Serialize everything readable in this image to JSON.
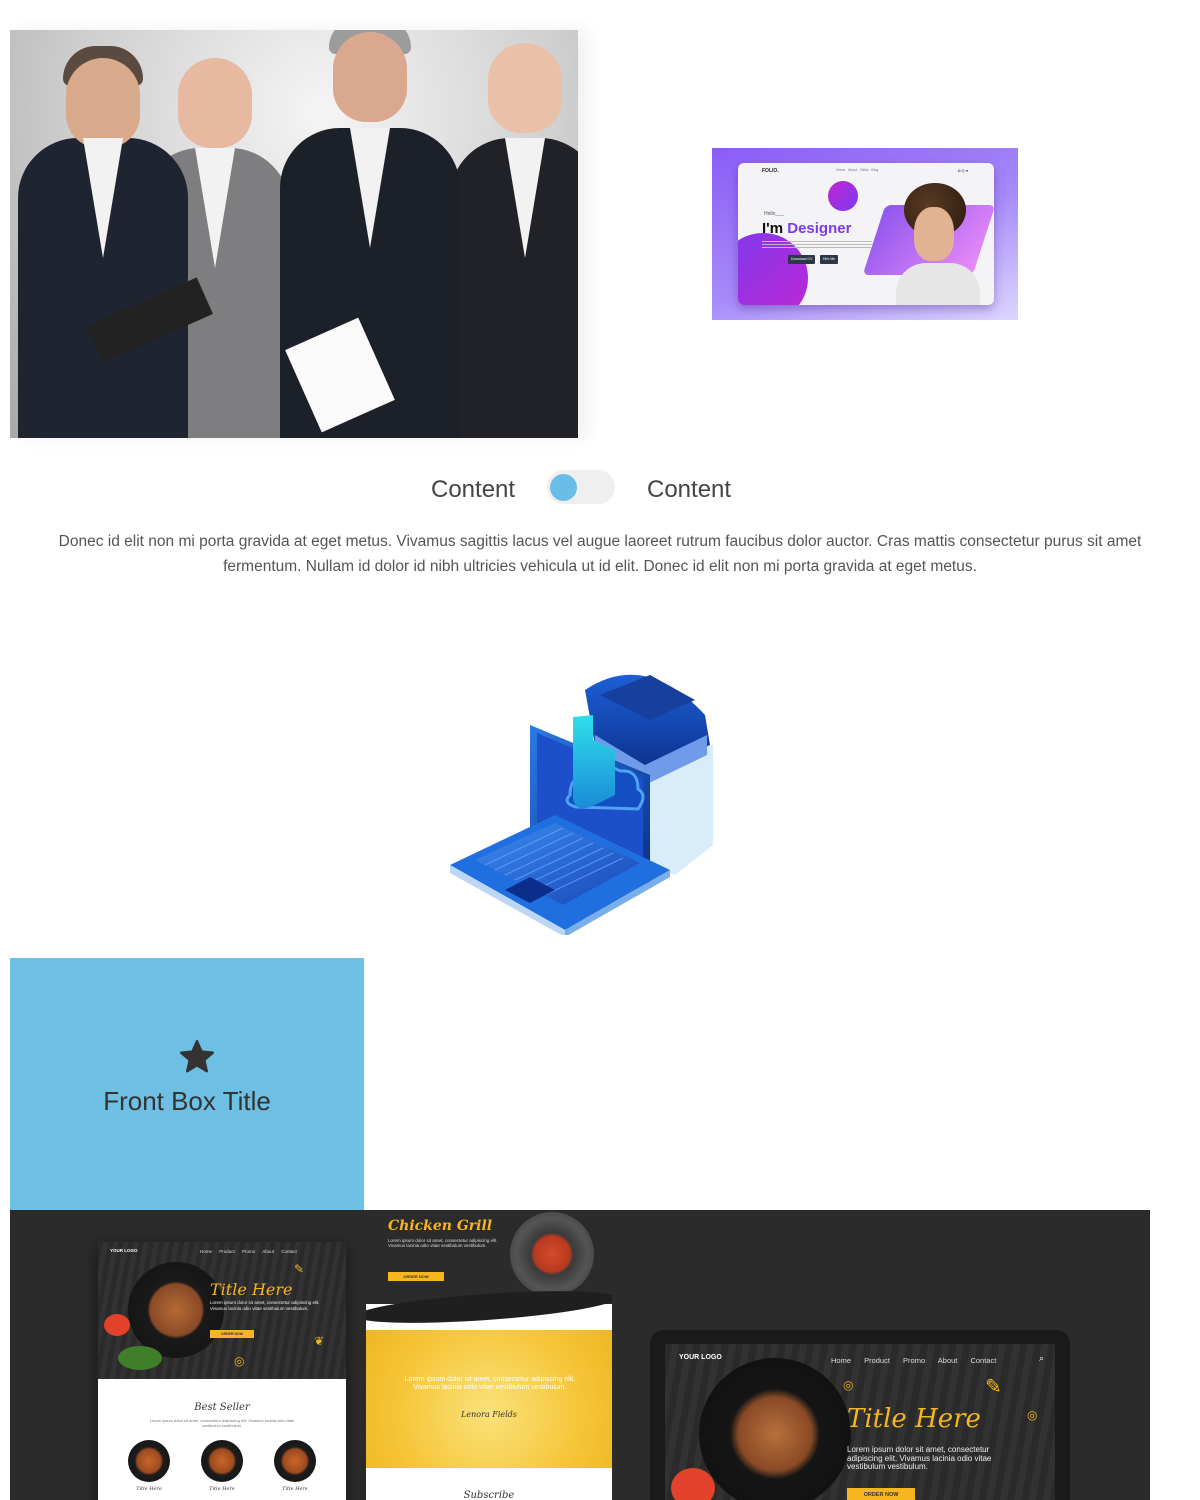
{
  "colors": {
    "accent_blue": "#6dbfe4",
    "toggle_knob": "#69bde7",
    "food_yellow": "#f7b51e",
    "dark_bg": "#2b2b2b",
    "designer_purple": "#7c3aed"
  },
  "designer_preview": {
    "logo": "FOLIO.",
    "nav": "Home About Skills Blog",
    "hello": "Hello___",
    "headline_prefix": "I'm ",
    "headline_accent": "Designer",
    "btn_cv": "Download CV",
    "btn_hire": "Hire Me"
  },
  "toggle": {
    "left_label": "Content",
    "right_label": "Content",
    "state": "off"
  },
  "paragraph": "Donec id elit non mi porta gravida at eget metus. Vivamus sagittis lacus vel augue laoreet rutrum faucibus dolor auctor. Cras mattis consectetur purus sit amet fermentum. Nullam id dolor id nibh ultricies vehicula ut id elit. Donec id elit non mi porta gravida at eget metus.",
  "front_box": {
    "icon": "star-icon",
    "title": "Front Box Title"
  },
  "food_site_a": {
    "logo": "YOUR LOGO",
    "nav": "Home Product Promo About Contact",
    "title": "Title Here",
    "text": "Lorem ipsum dolor sit amet, consectetur adipiscing elit. Vivamus lacinia odio vitae vestibulum vestibulum.",
    "button": "ORDER NOW",
    "best_seller": "Best Seller",
    "best_seller_text": "Lorem ipsum dolor sit amet, consectetur adipiscing elit. Vivamus lacinia odio vitae vestibulum vestibulum.",
    "dishes": [
      "Title Here",
      "Title Here",
      "Title Here"
    ]
  },
  "food_site_b": {
    "title": "Chicken Grill",
    "text": "Lorem ipsum dolor sit amet, consectetur adipiscing elit. Vivamus lacinia odio vitae vestibulum vestibulum.",
    "button": "ORDER NOW",
    "yellow_text": "Lorem ipsum dolor sit amet, consectetur adipiscing elit. Vivamus lacinia odio vitae vestibulum vestibulum.",
    "signature": "Lenora Fields",
    "subscribe": "Subscribe"
  },
  "food_tablet": {
    "logo": "YOUR LOGO",
    "nav": "Home Product Promo About Contact",
    "title": "Title Here",
    "text": "Lorem ipsum dolor sit amet, consectetur adipiscing elit. Vivamus lacinia odio vitae vestibulum vestibulum.",
    "button": "ORDER NOW"
  }
}
